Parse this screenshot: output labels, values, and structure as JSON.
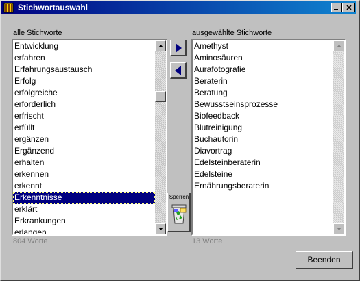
{
  "window": {
    "title": "Stichwortauswahl",
    "controls": {
      "minimize": "minimize-icon",
      "maximize": "maximize-icon",
      "close": "close-icon"
    }
  },
  "left_panel": {
    "label": "alle Stichworte",
    "items": [
      "Entwicklung",
      "erfahren",
      "Erfahrungsaustausch",
      "Erfolg",
      "erfolgreiche",
      "erforderlich",
      "erfrischt",
      "erfüllt",
      "ergänzen",
      "Ergänzend",
      "erhalten",
      "erkennen",
      "erkennt",
      "Erkenntnisse",
      "erklärt",
      "Erkrankungen",
      "erlangen"
    ],
    "selected": "Erkenntnisse",
    "count": "804 Worte"
  },
  "right_panel": {
    "label": "ausgewählte Stichworte",
    "items": [
      "Amethyst",
      "Aminosäuren",
      "Aurafotografie",
      "Beraterin",
      "Beratung",
      "Bewusstseinsprozesse",
      "Biofeedback",
      "Blutreinigung",
      "Buchautorin",
      "Diavortrag",
      "Edelsteinberaterin",
      "Edelsteine",
      "Ernährungsberaterin"
    ],
    "count": "13 Worte"
  },
  "buttons": {
    "add_icon": "arrow-right-icon",
    "remove_icon": "arrow-left-icon",
    "sperren": "Sperren",
    "sperren_icon": "recycle-bin-icon",
    "beenden": "Beenden"
  },
  "colors": {
    "titlebar_start": "#000080",
    "titlebar_end": "#1084d0",
    "selection": "#000080",
    "arrow_blue": "#000080"
  }
}
